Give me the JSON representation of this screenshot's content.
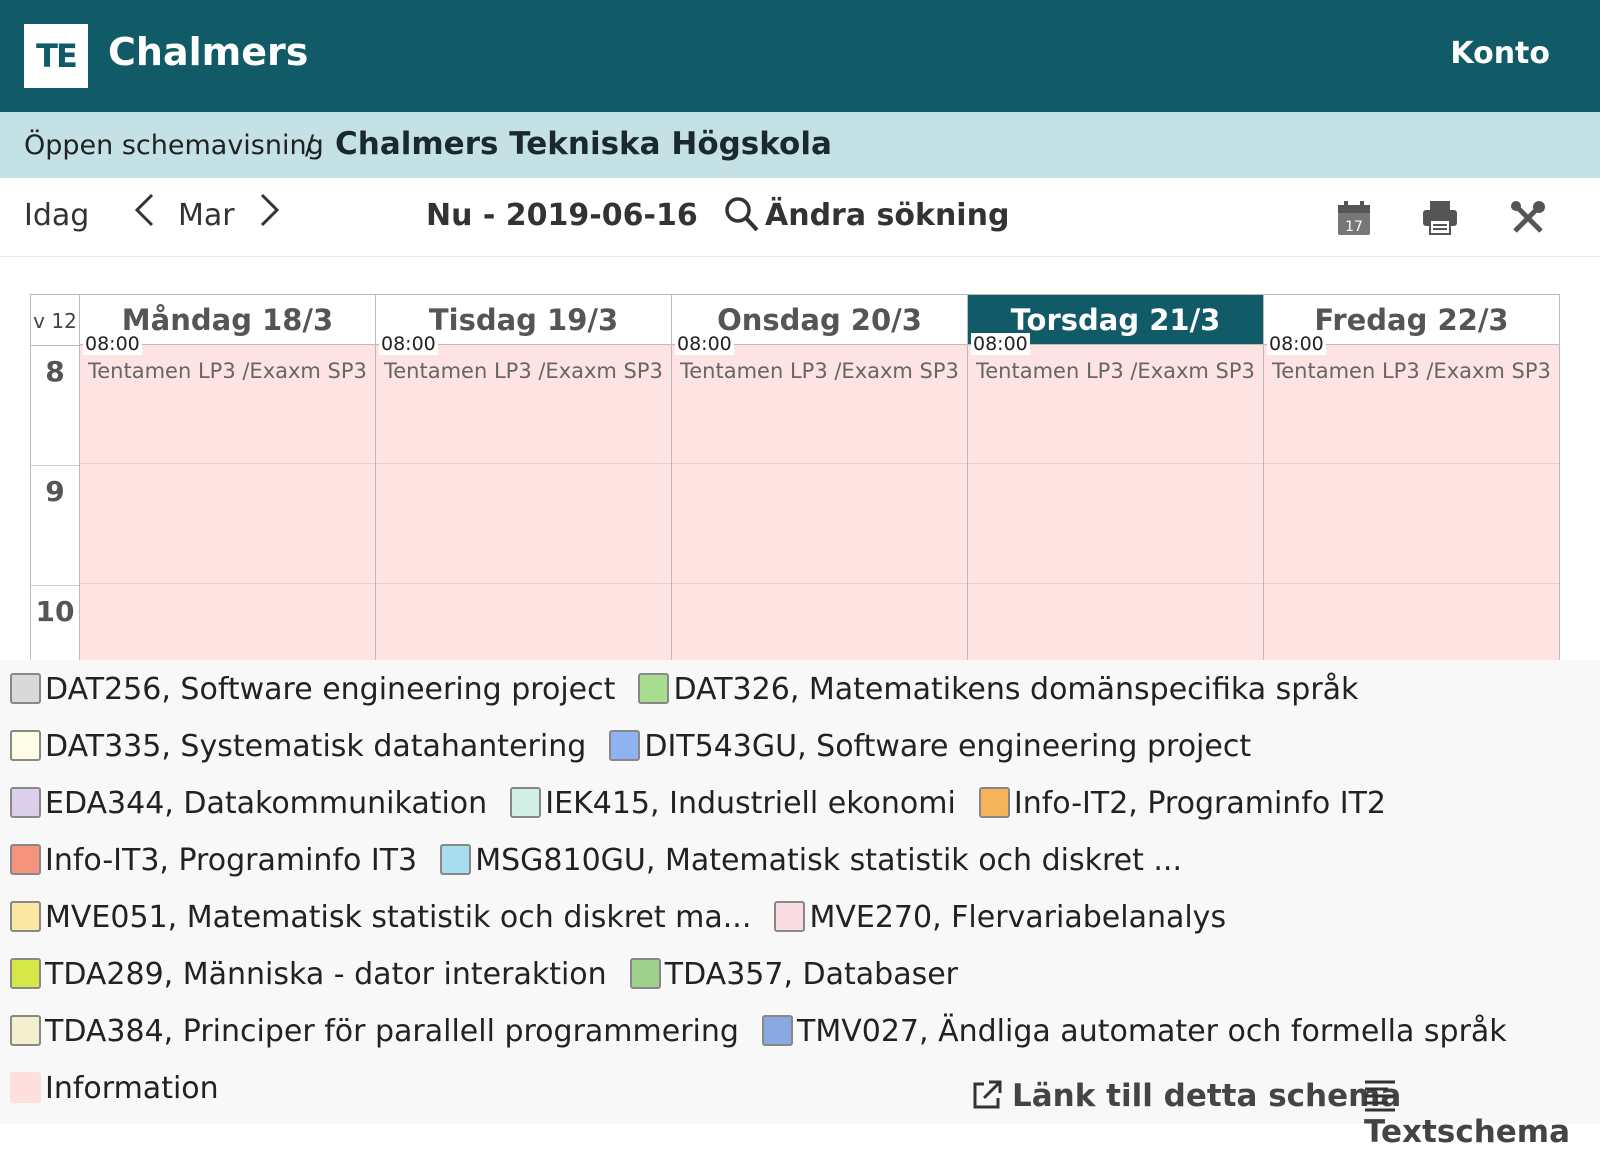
{
  "header": {
    "logo": "TE",
    "title": "Chalmers",
    "account": "Konto"
  },
  "breadcrumb": {
    "first": "Öppen schemavisning",
    "sep": "/",
    "current": "Chalmers Tekniska Högskola"
  },
  "toolbar": {
    "today": "Idag",
    "prev": "<",
    "month": "Mar",
    "next": ">",
    "range": "Nu - 2019-06-16",
    "change_search": "Ändra sökning",
    "calendar_day": "17"
  },
  "schedule": {
    "week": "v 12",
    "hours": [
      "8",
      "9",
      "10"
    ],
    "days": [
      {
        "label": "Måndag 18/3",
        "time": "08:00",
        "event": "Tentamen LP3 /Exaxm SP3"
      },
      {
        "label": "Tisdag 19/3",
        "time": "08:00",
        "event": "Tentamen LP3 /Exaxm SP3"
      },
      {
        "label": "Onsdag 20/3",
        "time": "08:00",
        "event": "Tentamen LP3 /Exaxm SP3"
      },
      {
        "label": "Torsdag 21/3",
        "time": "08:00",
        "event": "Tentamen LP3 /Exaxm SP3"
      },
      {
        "label": "Fredag 22/3",
        "time": "08:00",
        "event": "Tentamen LP3 /Exaxm SP3"
      }
    ],
    "event_color": "#fde3e1"
  },
  "legend": [
    {
      "label": "DAT256, Software engineering project",
      "color": "#d9d9d9"
    },
    {
      "label": "DAT326, Matematikens domänspecifika språk",
      "color": "#a8dc8e"
    },
    {
      "label": "DAT335, Systematisk datahantering",
      "color": "#fffde6"
    },
    {
      "label": "DIT543GU, Software engineering project",
      "color": "#8fb3f0"
    },
    {
      "label": "EDA344, Datakommunikation",
      "color": "#dccfea"
    },
    {
      "label": "IEK415, Industriell ekonomi",
      "color": "#d3f0e6"
    },
    {
      "label": "Info-IT2, Programinfo IT2",
      "color": "#f7b35a"
    },
    {
      "label": "Info-IT3, Programinfo IT3",
      "color": "#f6937e"
    },
    {
      "label": "MSG810GU, Matematisk statistik och diskret ...",
      "color": "#a9dcee"
    },
    {
      "label": "MVE051, Matematisk statistik och diskret ma...",
      "color": "#fde8a3"
    },
    {
      "label": "MVE270, Flervariabelanalys",
      "color": "#fadde3"
    },
    {
      "label": "TDA289, Människa - dator interaktion",
      "color": "#d6e847"
    },
    {
      "label": "TDA357, Databaser",
      "color": "#9fd18d"
    },
    {
      "label": "TDA384, Principer för parallell programmering",
      "color": "#f3efcf"
    },
    {
      "label": "TMV027, Ändliga automater och formella språk",
      "color": "#8aa9e0"
    },
    {
      "label": "Information",
      "color": "#fde0dd"
    }
  ],
  "footer": {
    "link": "Länk till detta schema",
    "text_schedule": "Textschema"
  }
}
